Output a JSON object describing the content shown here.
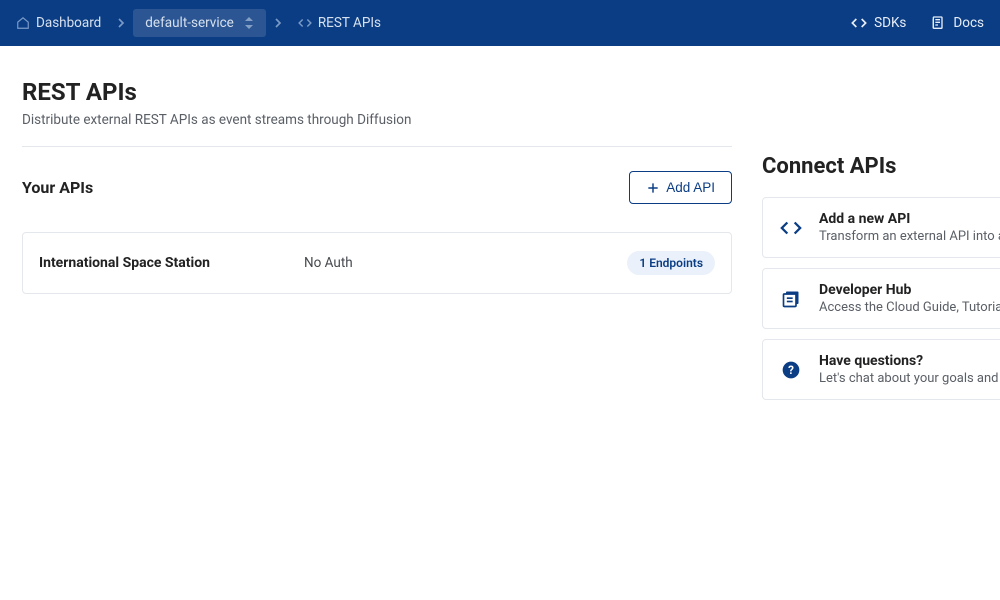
{
  "breadcrumb": {
    "dashboard": "Dashboard",
    "service": "default-service",
    "current": "REST APIs"
  },
  "topbar": {
    "sdks": "SDKs",
    "docs": "Docs"
  },
  "page": {
    "title": "REST APIs",
    "subtitle": "Distribute external REST APIs as event streams through Diffusion"
  },
  "your_apis": {
    "heading": "Your APIs",
    "add_button": "Add API",
    "items": [
      {
        "name": "International Space Station",
        "auth": "No Auth",
        "endpoints_badge": "1 Endpoints"
      }
    ]
  },
  "connect": {
    "heading": "Connect APIs",
    "cards": [
      {
        "title": "Add a new API",
        "subtitle": "Transform an external API into a realtime stream"
      },
      {
        "title": "Developer Hub",
        "subtitle": "Access the Cloud Guide, Tutorials and more"
      },
      {
        "title": "Have questions?",
        "subtitle": "Let's chat about your goals and needs"
      }
    ]
  }
}
